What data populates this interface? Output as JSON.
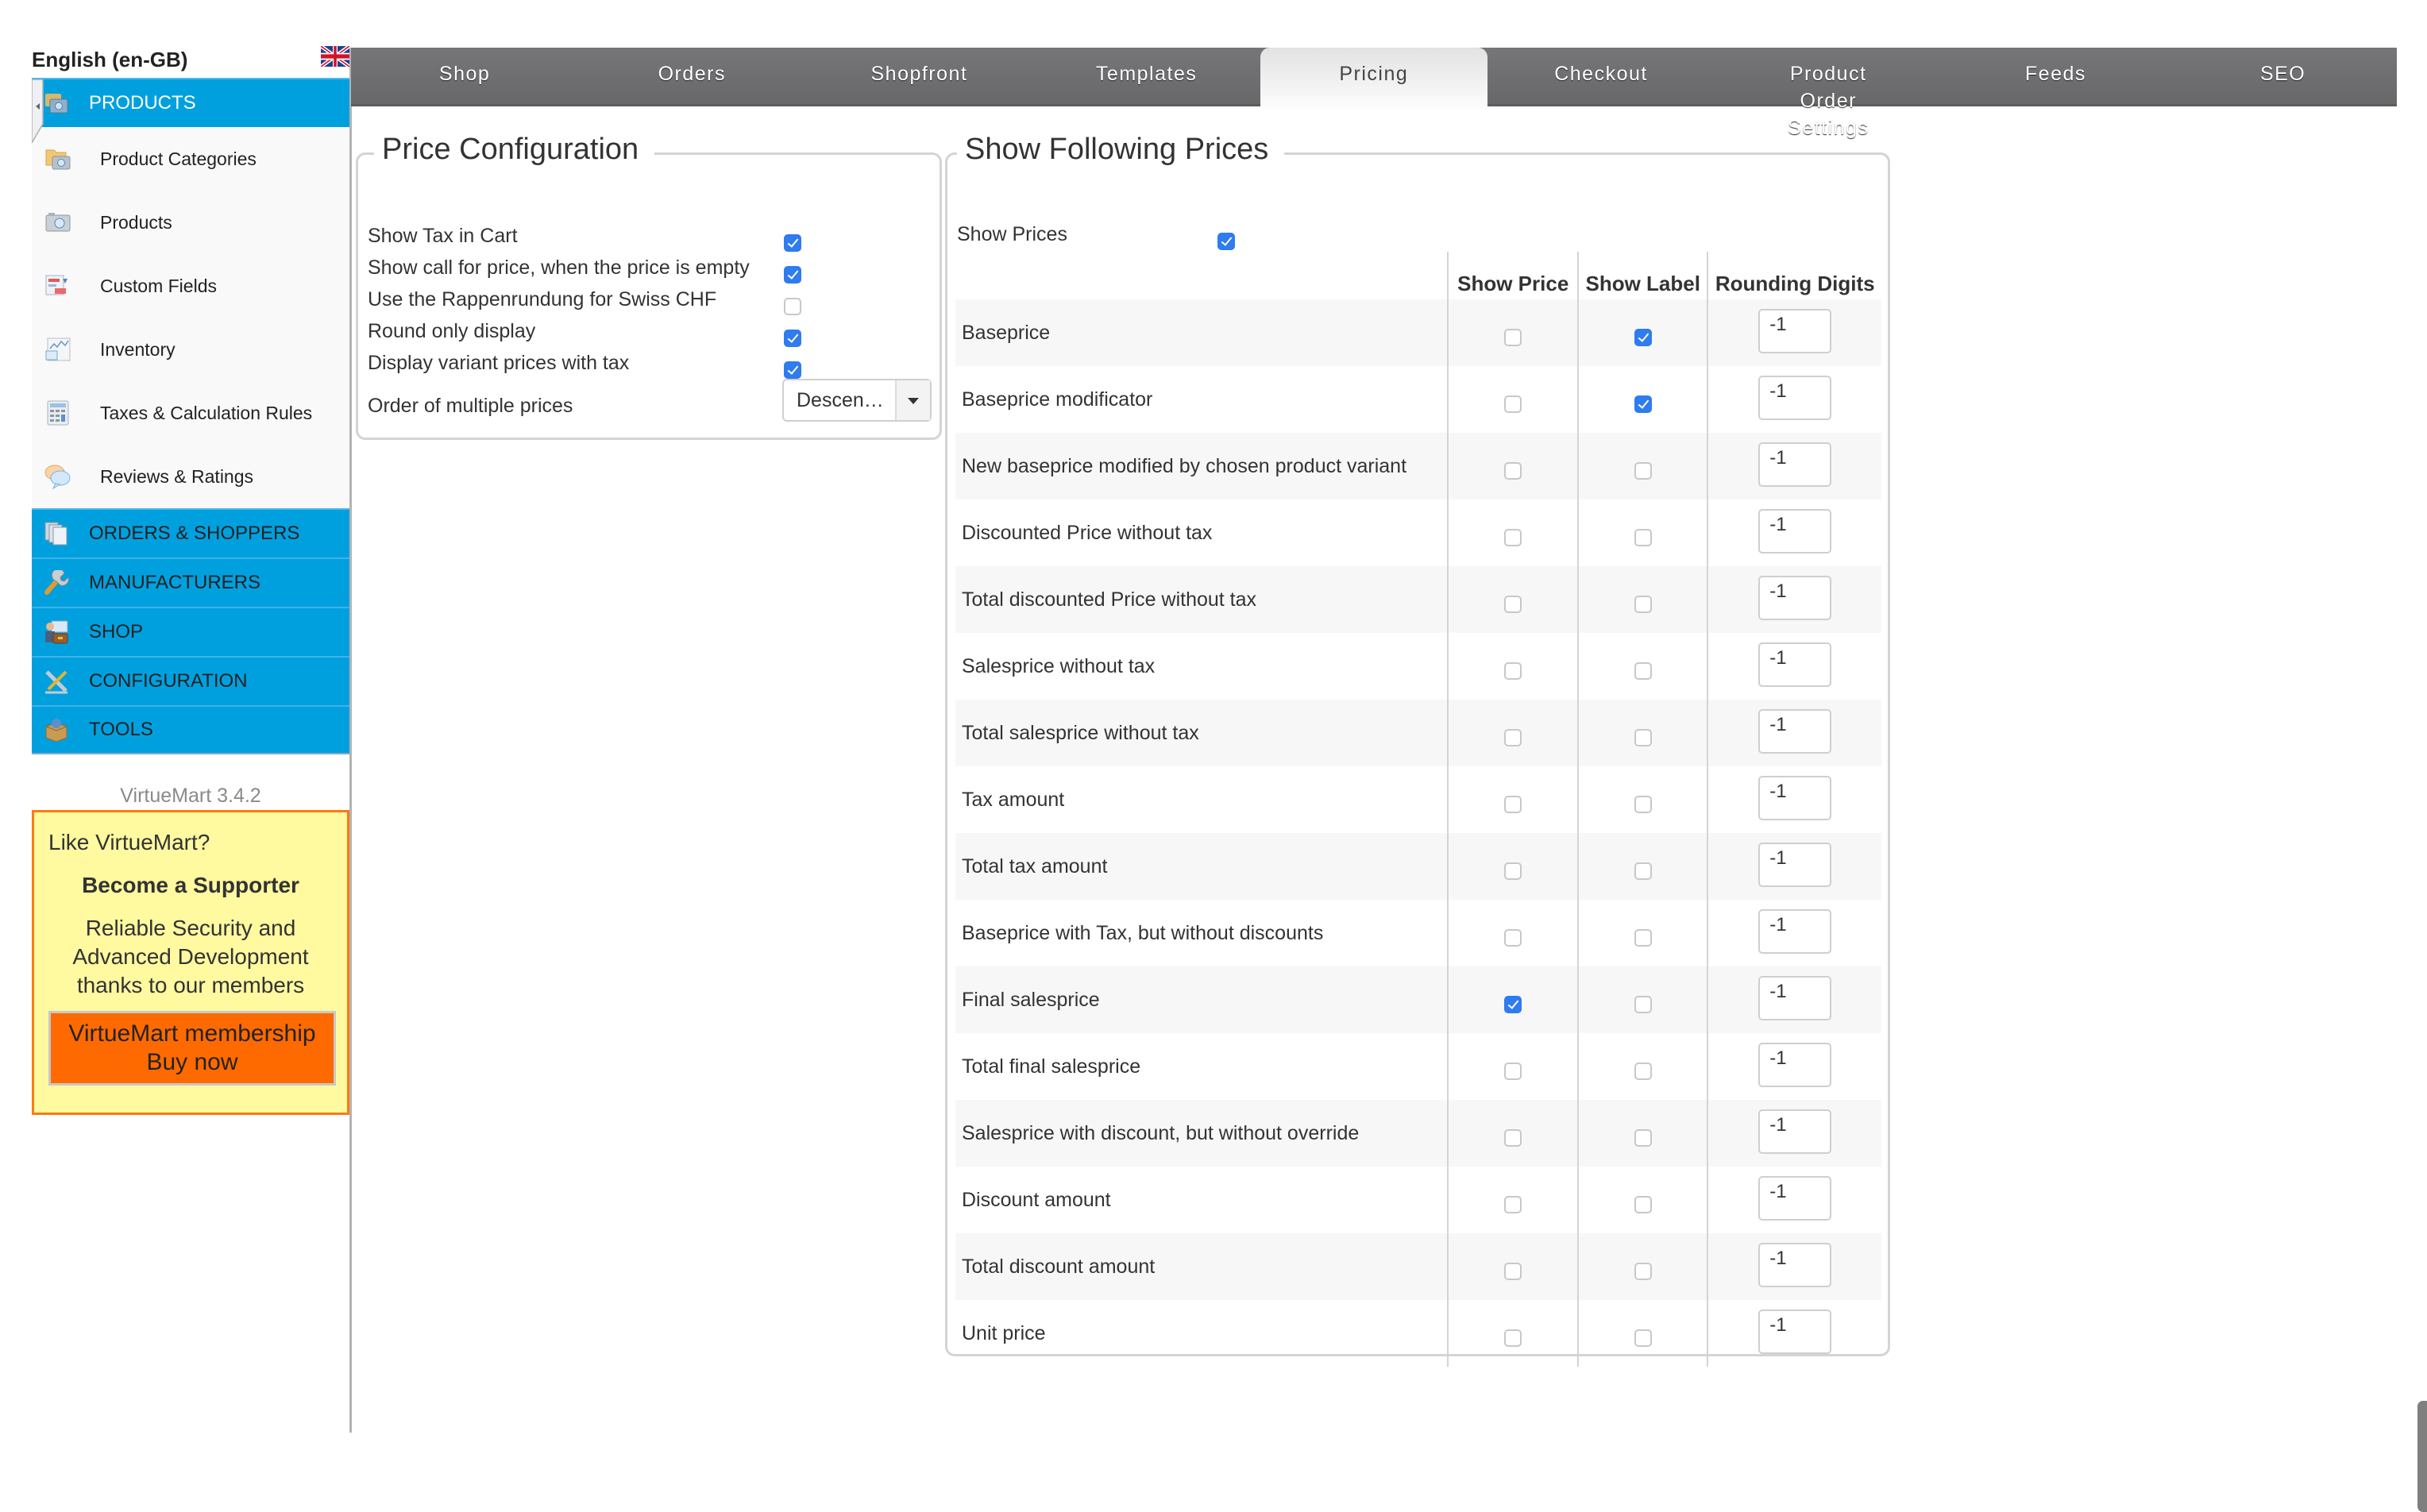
{
  "language": {
    "label": "English (en-GB)",
    "flag": "uk-flag-icon"
  },
  "sidebar": {
    "sections": [
      {
        "label": "PRODUCTS",
        "icon": "products-icon",
        "active": true,
        "items": [
          {
            "label": "Product Categories",
            "icon": "product-categories-icon"
          },
          {
            "label": "Products",
            "icon": "products-camera-icon"
          },
          {
            "label": "Custom Fields",
            "icon": "custom-fields-icon"
          },
          {
            "label": "Inventory",
            "icon": "inventory-chart-icon"
          },
          {
            "label": "Taxes & Calculation Rules",
            "icon": "calculator-icon"
          },
          {
            "label": "Reviews & Ratings",
            "icon": "speech-bubbles-icon"
          }
        ]
      },
      {
        "label": "ORDERS & SHOPPERS",
        "icon": "documents-icon"
      },
      {
        "label": "MANUFACTURERS",
        "icon": "wrench-icon"
      },
      {
        "label": "SHOP",
        "icon": "shop-briefcase-icon"
      },
      {
        "label": "CONFIGURATION",
        "icon": "tools-config-icon"
      },
      {
        "label": "TOOLS",
        "icon": "toolbox-icon"
      }
    ],
    "version": "VirtueMart 3.4.2",
    "promo": {
      "heading": "Like VirtueMart?",
      "title": "Become a Supporter",
      "desc_lines": [
        "Reliable Security and",
        "Advanced Development",
        "thanks to our members"
      ],
      "button_lines": [
        "VirtueMart membership",
        "Buy now"
      ]
    }
  },
  "tabs": [
    {
      "label": "Shop"
    },
    {
      "label": "Orders"
    },
    {
      "label": "Shopfront"
    },
    {
      "label": "Templates"
    },
    {
      "label": "Pricing",
      "active": true
    },
    {
      "label": "Checkout"
    },
    {
      "label": "Product Order Settings"
    },
    {
      "label": "Feeds"
    },
    {
      "label": "SEO"
    }
  ],
  "price_config": {
    "title": "Price Configuration",
    "options": [
      {
        "label": "Show Tax in Cart",
        "checked": true
      },
      {
        "label": "Show call for price, when the price is empty",
        "checked": true
      },
      {
        "label": "Use the Rappenrundung for Swiss CHF",
        "checked": false
      },
      {
        "label": "Round only display",
        "checked": true
      },
      {
        "label": "Display variant prices with tax",
        "checked": true
      }
    ],
    "order_label": "Order of multiple prices",
    "order_value": "Descen…"
  },
  "show_prices": {
    "title": "Show Following Prices",
    "show_prices_label": "Show Prices",
    "show_prices_checked": true,
    "columns": [
      "Show Price",
      "Show Label",
      "Rounding Digits"
    ],
    "rows": [
      {
        "name": "Baseprice",
        "show_price": false,
        "show_label": true,
        "rounding": "-1"
      },
      {
        "name": "Baseprice modificator",
        "show_price": false,
        "show_label": true,
        "rounding": "-1"
      },
      {
        "name": "New baseprice modified by chosen product variant",
        "show_price": false,
        "show_label": false,
        "rounding": "-1"
      },
      {
        "name": "Discounted Price without tax",
        "show_price": false,
        "show_label": false,
        "rounding": "-1"
      },
      {
        "name": "Total discounted Price without tax",
        "show_price": false,
        "show_label": false,
        "rounding": "-1"
      },
      {
        "name": "Salesprice without tax",
        "show_price": false,
        "show_label": false,
        "rounding": "-1"
      },
      {
        "name": "Total salesprice without tax",
        "show_price": false,
        "show_label": false,
        "rounding": "-1"
      },
      {
        "name": "Tax amount",
        "show_price": false,
        "show_label": false,
        "rounding": "-1"
      },
      {
        "name": "Total tax amount",
        "show_price": false,
        "show_label": false,
        "rounding": "-1"
      },
      {
        "name": "Baseprice with Tax, but without discounts",
        "show_price": false,
        "show_label": false,
        "rounding": "-1"
      },
      {
        "name": "Final salesprice",
        "show_price": true,
        "show_label": false,
        "rounding": "-1"
      },
      {
        "name": "Total final salesprice",
        "show_price": false,
        "show_label": false,
        "rounding": "-1"
      },
      {
        "name": "Salesprice with discount, but without override",
        "show_price": false,
        "show_label": false,
        "rounding": "-1"
      },
      {
        "name": "Discount amount",
        "show_price": false,
        "show_label": false,
        "rounding": "-1"
      },
      {
        "name": "Total discount amount",
        "show_price": false,
        "show_label": false,
        "rounding": "-1"
      },
      {
        "name": "Unit price",
        "show_price": false,
        "show_label": false,
        "rounding": "-1"
      }
    ]
  },
  "colors": {
    "sidebar_blue": "#00a0df",
    "tab_gray": "#6e6e71",
    "checkbox_blue": "#2f7bf0",
    "promo_bg": "#fff9a0",
    "promo_border": "#ff7a10",
    "buy_button": "#ff6a00"
  }
}
